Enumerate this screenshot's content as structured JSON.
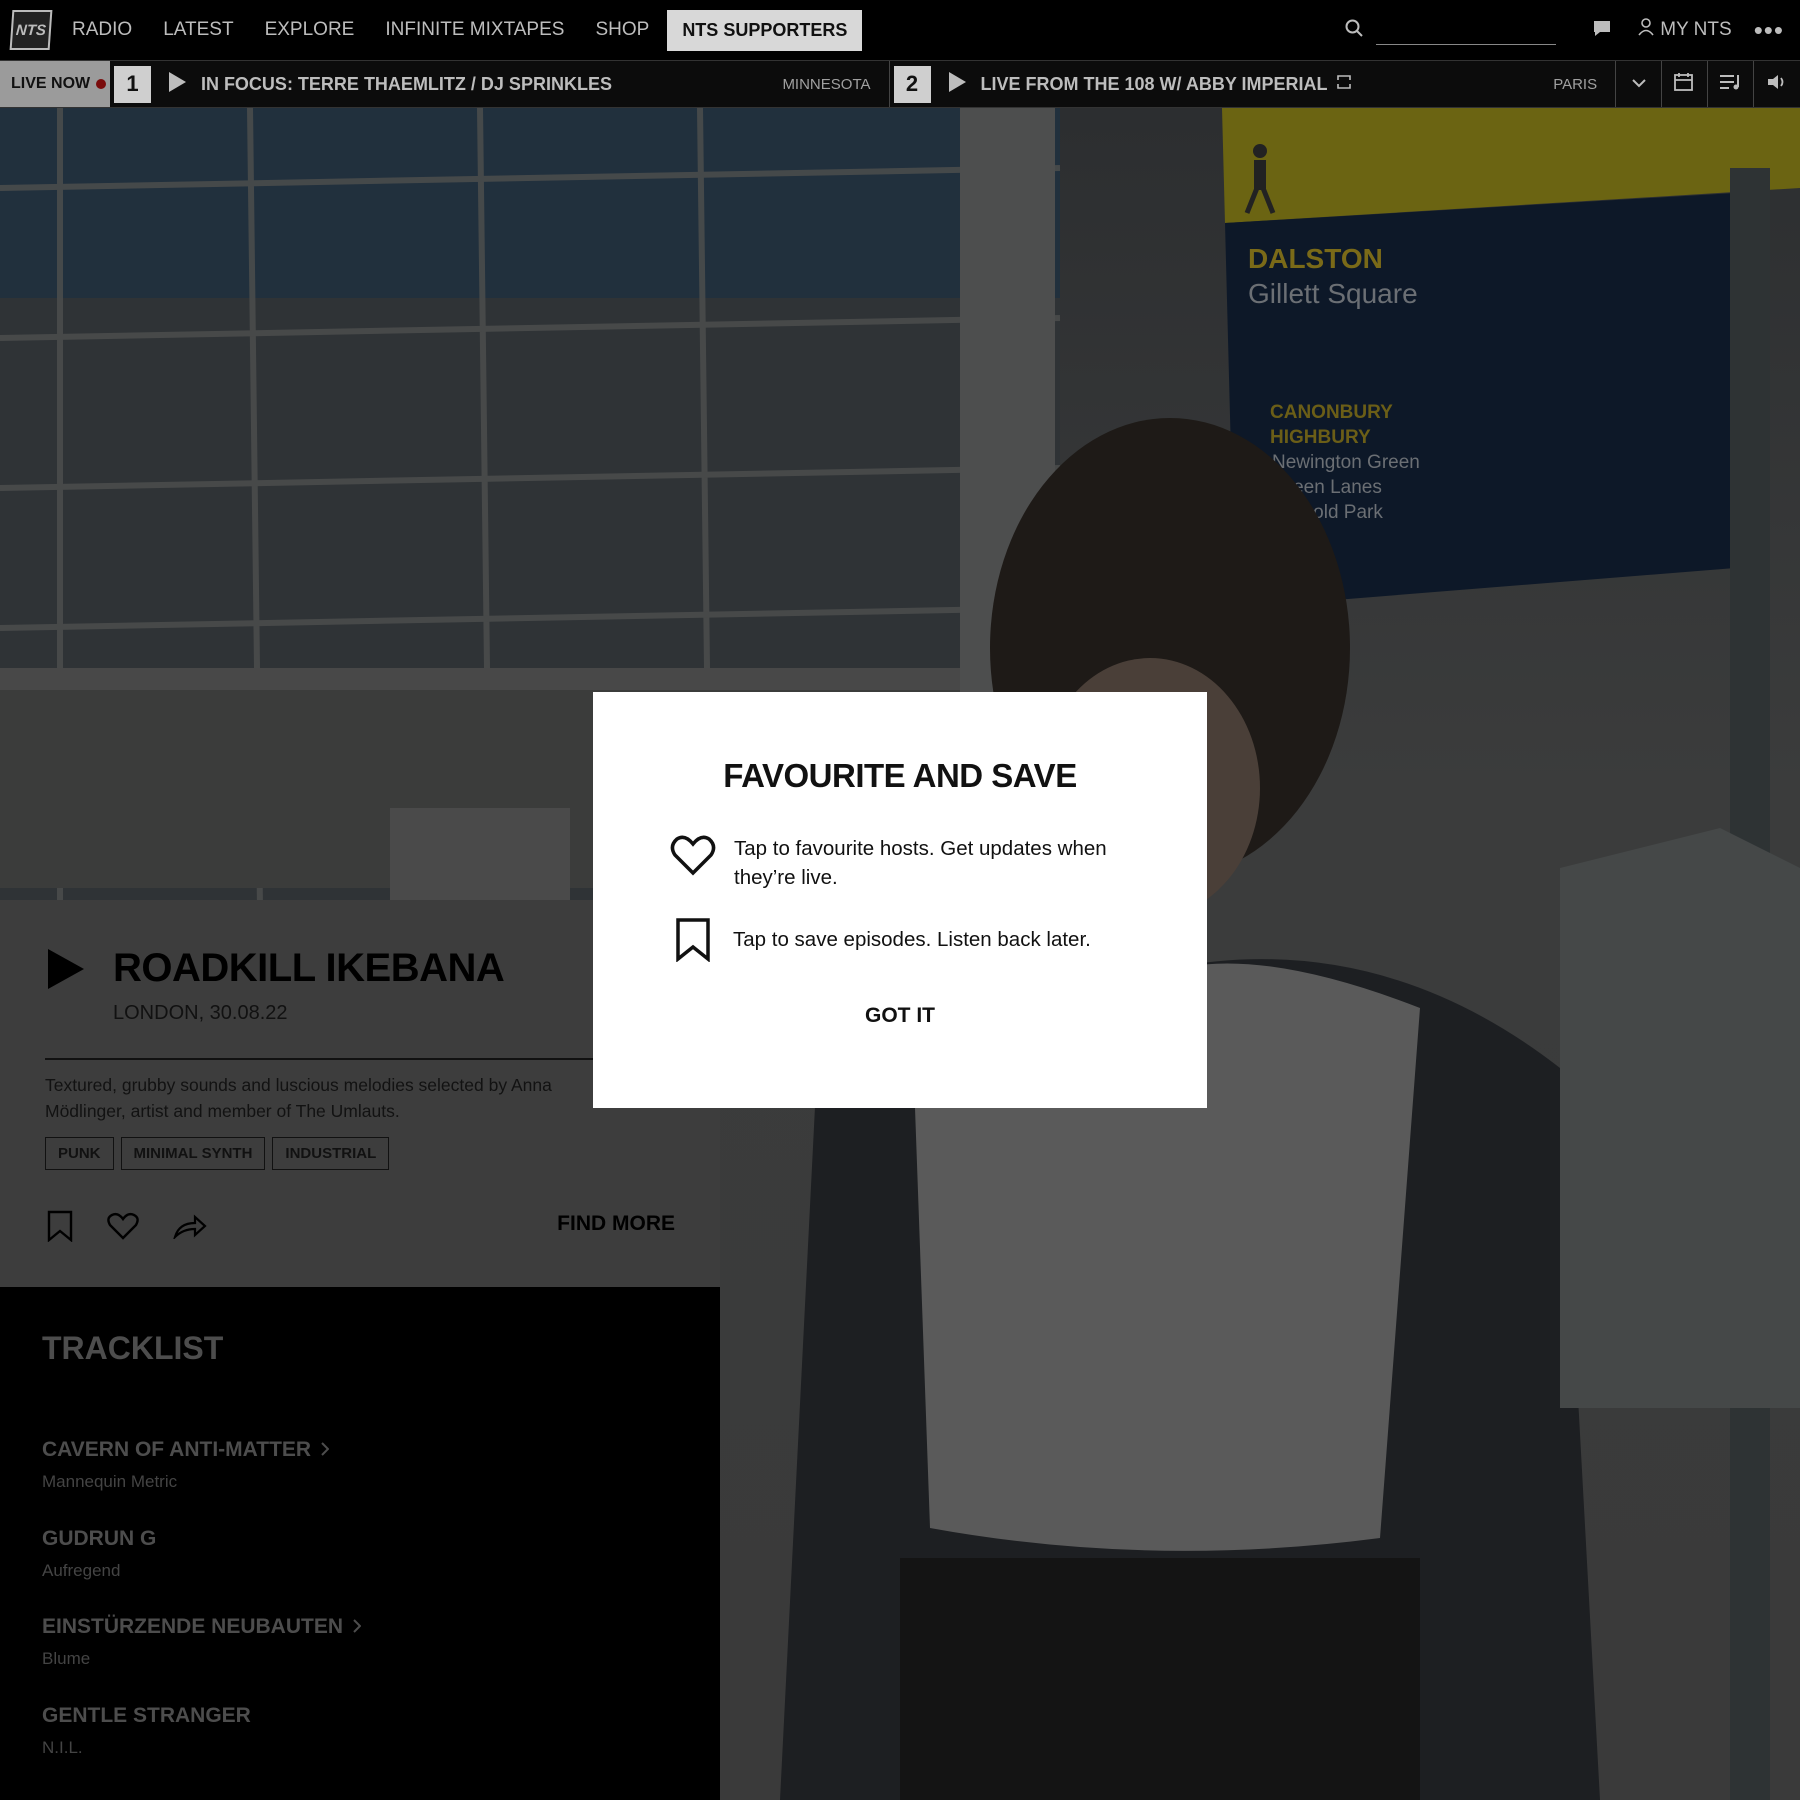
{
  "nav": {
    "logo": "NTS",
    "links": [
      "RADIO",
      "LATEST",
      "EXPLORE",
      "INFINITE MIXTAPES",
      "SHOP"
    ],
    "supporters": "NTS SUPPORTERS",
    "search_placeholder": "",
    "my_nts": "MY NTS"
  },
  "live": {
    "label": "LIVE NOW",
    "channels": [
      {
        "number": "1",
        "title": "IN FOCUS: TERRE THAEMLITZ / DJ SPRINKLES",
        "location": "MINNESOTA"
      },
      {
        "number": "2",
        "title": "LIVE FROM THE 108 W/ ABBY IMPERIAL",
        "location": "PARIS"
      }
    ]
  },
  "hero": {
    "sign_title": "DALSTON",
    "sign_subtitle": "Gillett Square",
    "sign_lines": [
      "CANONBURY",
      "HIGHBURY",
      "Newington Green",
      "Green Lanes",
      "Clissold Park"
    ]
  },
  "episode": {
    "title": "ROADKILL IKEBANA",
    "subtitle": "LONDON, 30.08.22",
    "description": "Textured, grubby sounds and luscious melodies selected by Anna Mödlinger, artist and member of The Umlauts.",
    "tags": [
      "PUNK",
      "MINIMAL SYNTH",
      "INDUSTRIAL"
    ],
    "find_more": "FIND MORE"
  },
  "tracklist": {
    "heading": "TRACKLIST",
    "tracks": [
      {
        "artist": "CAVERN OF ANTI-MATTER",
        "title": "Mannequin Metric",
        "has_link": true
      },
      {
        "artist": "GUDRUN G",
        "title": "Aufregend",
        "has_link": false
      },
      {
        "artist": "EINSTÜRZENDE NEUBAUTEN",
        "title": "Blume",
        "has_link": true
      },
      {
        "artist": "GENTLE STRANGER",
        "title": "N.I.L.",
        "has_link": false
      }
    ]
  },
  "modal": {
    "title": "FAVOURITE AND SAVE",
    "favourite_text": "Tap to favourite hosts. Get updates when they’re live.",
    "save_text": "Tap to save episodes. Listen back later.",
    "button": "GOT IT"
  },
  "colors": {
    "overlay_dim": "#000000",
    "modal_bg": "#ffffff",
    "sign_yellow": "#b8a313",
    "sign_blue": "#101c2e",
    "live_dot": "#7a0c0c"
  }
}
